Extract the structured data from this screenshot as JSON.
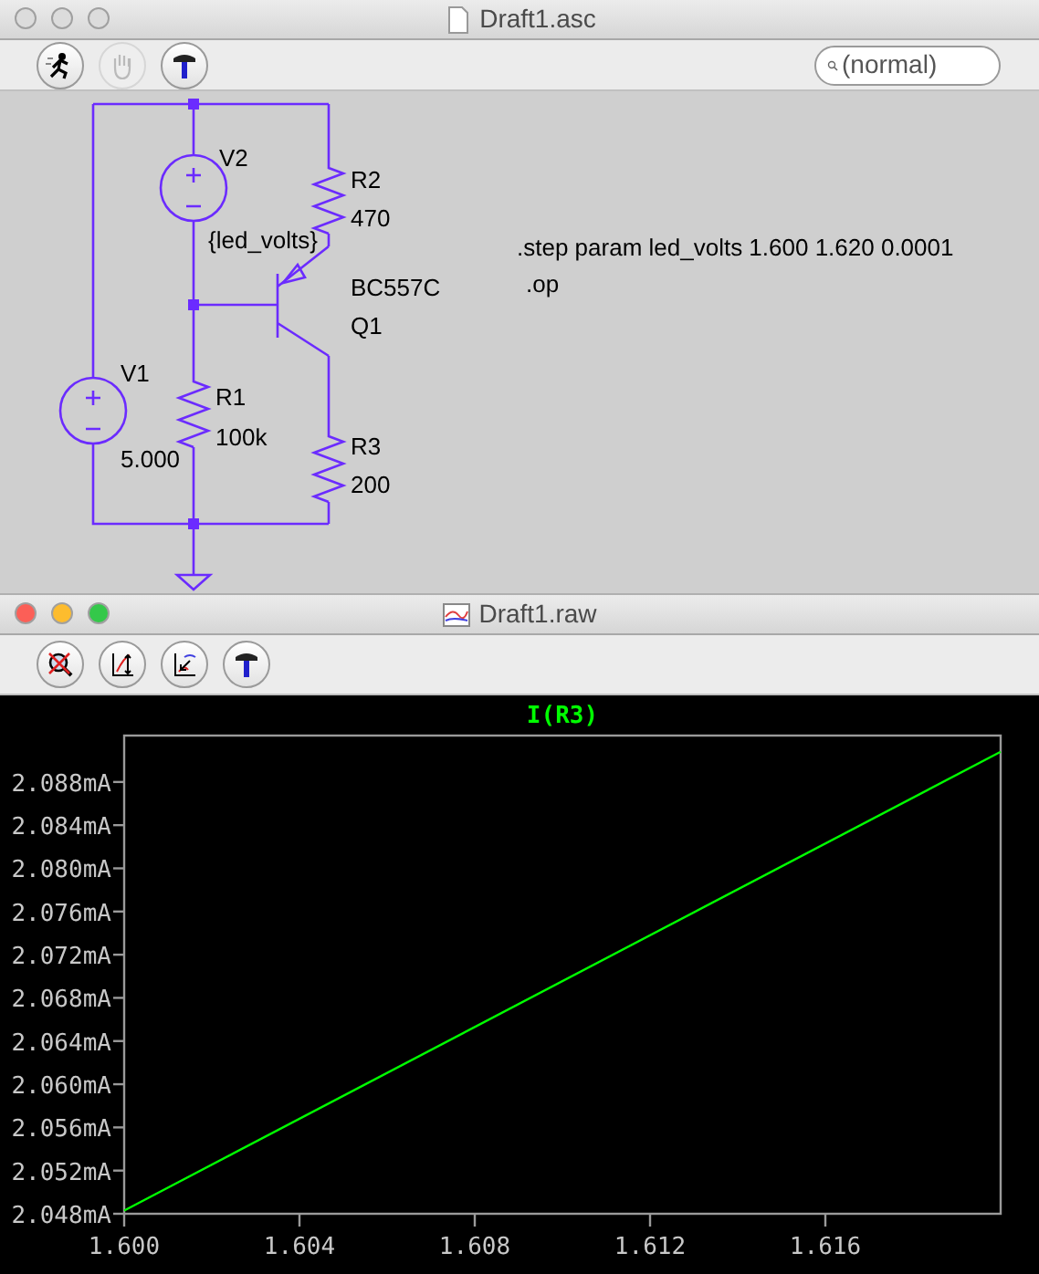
{
  "schematic_window": {
    "title": "Draft1.asc",
    "active": false,
    "toolbar": [
      {
        "disabled": false
      },
      {
        "disabled": true
      },
      {
        "disabled": false
      }
    ],
    "search": {
      "placeholder": "(normal)"
    },
    "labels": [
      {
        "text": "V2"
      },
      {
        "text": "{led_volts}"
      },
      {
        "text": "R2"
      },
      {
        "text": "470"
      },
      {
        "text": "BC557C"
      },
      {
        "text": "Q1"
      },
      {
        "text": "V1"
      },
      {
        "text": "5.000"
      },
      {
        "text": "R1"
      },
      {
        "text": "100k"
      },
      {
        "text": "R3"
      },
      {
        "text": "200"
      }
    ],
    "directives": [
      ".step param led_volts 1.600 1.620 0.0001",
      ".op"
    ]
  },
  "plot_window": {
    "title": "Draft1.raw",
    "active": true,
    "toolbar": [
      {
        "disabled": false
      },
      {
        "disabled": false
      },
      {
        "disabled": false
      },
      {
        "disabled": false
      }
    ],
    "chart_data": {
      "type": "line",
      "title": "I(R3)",
      "x": [
        1.6,
        1.62
      ],
      "series": [
        {
          "color": "#00ff00",
          "values": [
            2.0483,
            2.0908
          ]
        }
      ],
      "xlim": [
        1.6,
        1.62
      ],
      "ylim": [
        2.048,
        2.0923
      ],
      "xticks": [
        {
          "value": 1.6,
          "label": "1.600"
        },
        {
          "value": 1.604,
          "label": "1.604"
        },
        {
          "value": 1.608,
          "label": "1.608"
        },
        {
          "value": 1.612,
          "label": "1.612"
        },
        {
          "value": 1.616,
          "label": "1.616"
        }
      ],
      "yticks": [
        {
          "value": 2.048,
          "label": "2.048mA"
        },
        {
          "value": 2.052,
          "label": "2.052mA"
        },
        {
          "value": 2.056,
          "label": "2.056mA"
        },
        {
          "value": 2.06,
          "label": "2.060mA"
        },
        {
          "value": 2.064,
          "label": "2.064mA"
        },
        {
          "value": 2.068,
          "label": "2.068mA"
        },
        {
          "value": 2.072,
          "label": "2.072mA"
        },
        {
          "value": 2.076,
          "label": "2.076mA"
        },
        {
          "value": 2.08,
          "label": "2.080mA"
        },
        {
          "value": 2.084,
          "label": "2.084mA"
        },
        {
          "value": 2.088,
          "label": "2.088mA"
        }
      ]
    }
  }
}
